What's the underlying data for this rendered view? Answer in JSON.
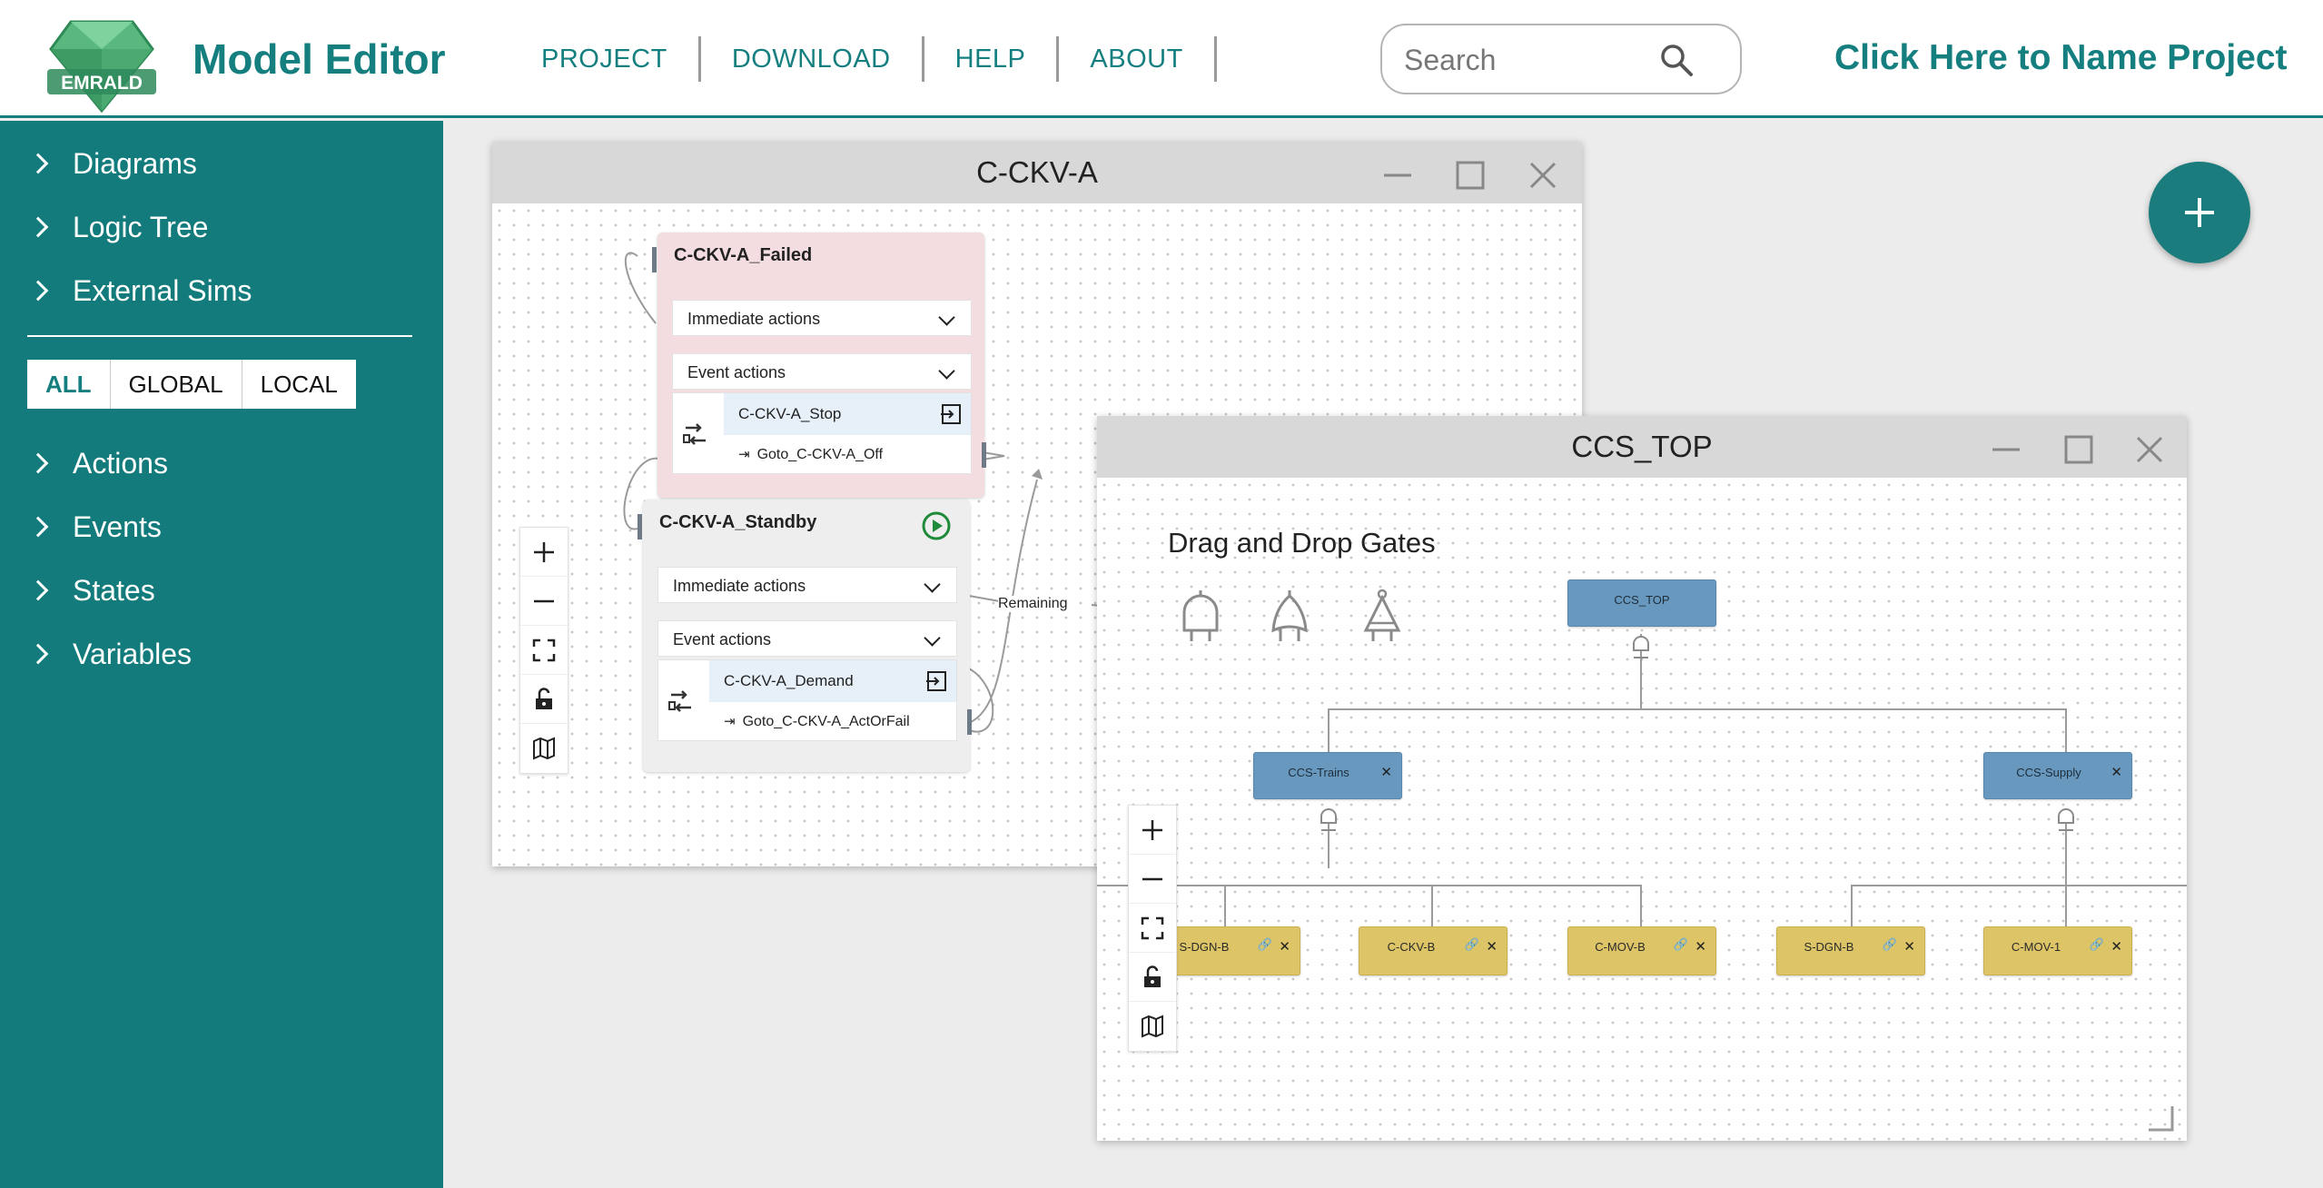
{
  "header": {
    "logo_text": "EMRALD",
    "app_title": "Model Editor",
    "nav": [
      "PROJECT",
      "DOWNLOAD",
      "HELP",
      "ABOUT"
    ],
    "search_placeholder": "Search",
    "project_name": "Click Here to Name Project"
  },
  "sidebar": {
    "top_items": [
      "Diagrams",
      "Logic Tree",
      "External Sims"
    ],
    "scope_tabs": [
      "ALL",
      "GLOBAL",
      "LOCAL"
    ],
    "active_scope": "ALL",
    "bottom_items": [
      "Actions",
      "Events",
      "States",
      "Variables"
    ]
  },
  "diagram_window": {
    "title": "C-CKV-A",
    "states": [
      {
        "name": "C-CKV-A_Failed",
        "immediate_label": "Immediate actions",
        "event_label": "Event actions",
        "event_name": "C-CKV-A_Stop",
        "event_action": "Goto_C-CKV-A_Off"
      },
      {
        "name": "C-CKV-A_Standby",
        "immediate_label": "Immediate actions",
        "event_label": "Event actions",
        "event_name": "C-CKV-A_Demand",
        "event_action": "Goto_C-CKV-A_ActOrFail"
      }
    ],
    "edge_label": "Remaining"
  },
  "logic_window": {
    "title": "CCS_TOP",
    "dnd_title": "Drag and Drop Gates",
    "top_gate": "CCS_TOP",
    "gates": [
      "CCS-Trains",
      "CCS-Supply"
    ],
    "leaves": [
      "S-DGN-B",
      "C-CKV-B",
      "C-MOV-B",
      "S-DGN-B",
      "C-MOV-1"
    ]
  },
  "fab_label": "+",
  "colors": {
    "brand": "#157f80",
    "failed_state": "#f4dde0",
    "standby_state": "#eeeeee",
    "gate": "#6898be",
    "leaf": "#dcc467"
  }
}
